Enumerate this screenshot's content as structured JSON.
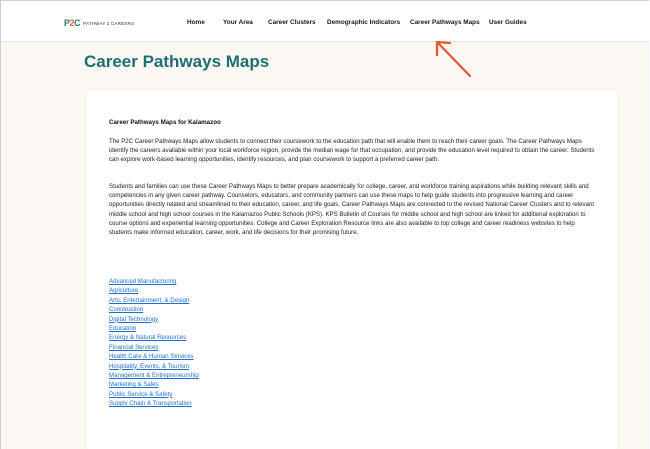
{
  "header": {
    "logo_text": "PATHWAY 2 CAREERS",
    "nav": [
      "Home",
      "Your Area",
      "Career Clusters",
      "Demographic Indicators",
      "Career Pathways Maps",
      "User Guides"
    ]
  },
  "page": {
    "title": "Career Pathways Maps"
  },
  "card": {
    "heading": "Career Pathways Maps for Kalamazoo",
    "paragraph1": "The P2C Career Pathways Maps allow students to connect their coursework to the education path that will enable them to reach their career goals. The Career Pathways Maps identify the careers available within your local workforce region, provide the median wage for that occupation, and provide the education level required to obtain the career. Students can explore work-based learning opportunities, identify resources, and plan coursework to support a preferred career path.",
    "paragraph2": "Students and families can use these Career Pathways Maps to better prepare academically for college, career, and workforce training aspirations while building relevant skills and competencies in any given career pathway. Counselors, educators, and community partners can use these maps to help guide students into progressive learning and career opportunities directly related and streamlined to their education, career, and life goals. Career Pathways Maps are connected to the revised National Career Clusters and to relevant middle school and high school courses in the Kalamazoo Public Schools (KPS). KPS Bulletin of Courses for middle school and high school are linked for additional exploration to course options and experiential learning opportunities. College and Career Exploration Resource links are also available to top college and career readiness websites to help students make informed education, career, work, and life decisions for their promising future.",
    "links": [
      "Advanced Manufacturing",
      "Agriculture",
      "Arts, Entertainment, & Design",
      "Construction",
      "Digital Technology",
      "Education",
      "Energy & Natural Resources",
      "Financial Services",
      "Health Care & Human Services",
      "Hospitality, Events, & Tourism",
      "Management & Entrepreneurship",
      "Marketing & Sales",
      "Public Service & Safety",
      "Supply Chain & Transportation"
    ]
  },
  "colors": {
    "title": "#1e6f73",
    "link": "#1f6fd1",
    "arrow": "#e8552b",
    "page_bg": "#fbf7f3"
  }
}
